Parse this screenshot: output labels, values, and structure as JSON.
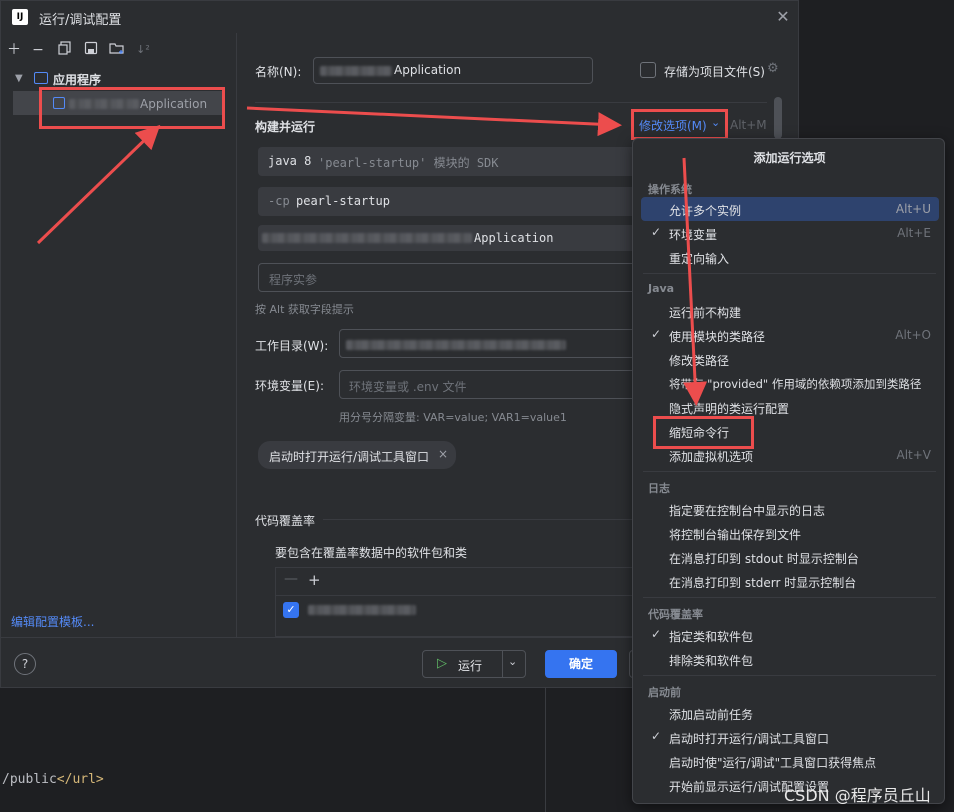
{
  "editor": {
    "code_text": "/public",
    "code_tag": "</url>"
  },
  "dialog": {
    "title": "运行/调试配置",
    "app_icon_text": "IJ",
    "close_symbol": "✕"
  },
  "tree": {
    "root_label": "应用程序",
    "child_label": "Application",
    "edit_templates_link": "编辑配置模板..."
  },
  "form": {
    "name_label": "名称(N):",
    "name_value": "Application",
    "store_label": "存储为项目文件(S)",
    "build_run_title": "构建并运行",
    "modify_options": "修改选项(M)",
    "modify_shortcut": "Alt+M",
    "jdk_value": "java 8",
    "jdk_suffix": "'pearl-startup' 模块的 SDK",
    "cp_flag": "-cp",
    "cp_value": "pearl-startup",
    "main_class_value": "Application",
    "program_args_placeholder": "程序实参",
    "alt_hint": "按 Alt 获取字段提示",
    "workdir_label": "工作目录(W):",
    "env_label": "环境变量(E):",
    "env_placeholder": "环境变量或  .env  文件",
    "env_hint": "用分号分隔变量: VAR=value; VAR1=value1",
    "chip_label": "启动时打开运行/调试工具窗口",
    "coverage_title": "代码覆盖率",
    "coverage_sub": "要包含在覆盖率数据中的软件包和类"
  },
  "buttons": {
    "run": "运行",
    "ok": "确定",
    "help": "?"
  },
  "popup": {
    "title": "添加运行选项",
    "sections": [
      {
        "name": "操作系统",
        "items": [
          {
            "label": "允许多个实例",
            "shortcut": "Alt+U",
            "checked": false,
            "highlighted": true
          },
          {
            "label": "环境变量",
            "shortcut": "Alt+E",
            "checked": true,
            "highlighted": false
          },
          {
            "label": "重定向输入",
            "shortcut": "",
            "checked": false,
            "highlighted": false
          }
        ]
      },
      {
        "name": "Java",
        "items": [
          {
            "label": "运行前不构建",
            "shortcut": "",
            "checked": false,
            "highlighted": false
          },
          {
            "label": "使用模块的类路径",
            "shortcut": "Alt+O",
            "checked": true,
            "highlighted": false
          },
          {
            "label": "修改类路径",
            "shortcut": "",
            "checked": false,
            "highlighted": false
          },
          {
            "label": "将带有 \"provided\" 作用域的依赖项添加到类路径",
            "shortcut": "",
            "checked": false,
            "highlighted": false
          },
          {
            "label": "隐式声明的类运行配置",
            "shortcut": "",
            "checked": false,
            "highlighted": false
          },
          {
            "label": "缩短命令行",
            "shortcut": "",
            "checked": false,
            "highlighted": false
          },
          {
            "label": "添加虚拟机选项",
            "shortcut": "Alt+V",
            "checked": false,
            "highlighted": false
          }
        ]
      },
      {
        "name": "日志",
        "items": [
          {
            "label": "指定要在控制台中显示的日志",
            "shortcut": "",
            "checked": false,
            "highlighted": false
          },
          {
            "label": "将控制台输出保存到文件",
            "shortcut": "",
            "checked": false,
            "highlighted": false
          },
          {
            "label": "在消息打印到 stdout 时显示控制台",
            "shortcut": "",
            "checked": false,
            "highlighted": false
          },
          {
            "label": "在消息打印到 stderr 时显示控制台",
            "shortcut": "",
            "checked": false,
            "highlighted": false
          }
        ]
      },
      {
        "name": "代码覆盖率",
        "items": [
          {
            "label": "指定类和软件包",
            "shortcut": "",
            "checked": true,
            "highlighted": false
          },
          {
            "label": "排除类和软件包",
            "shortcut": "",
            "checked": false,
            "highlighted": false
          }
        ]
      },
      {
        "name": "启动前",
        "items": [
          {
            "label": "添加启动前任务",
            "shortcut": "",
            "checked": false,
            "highlighted": false
          },
          {
            "label": "启动时打开运行/调试工具窗口",
            "shortcut": "",
            "checked": true,
            "highlighted": false
          },
          {
            "label": "启动时使\"运行/调试\"工具窗口获得焦点",
            "shortcut": "",
            "checked": false,
            "highlighted": false
          },
          {
            "label": "开始前显示运行/调试配置设置",
            "shortcut": "",
            "checked": false,
            "highlighted": false
          }
        ]
      }
    ]
  },
  "watermark": "CSDN @程序员丘山",
  "colors": {
    "accent": "#3574f0",
    "annotation": "#ec4d4d",
    "highlight": "#2e436e"
  }
}
